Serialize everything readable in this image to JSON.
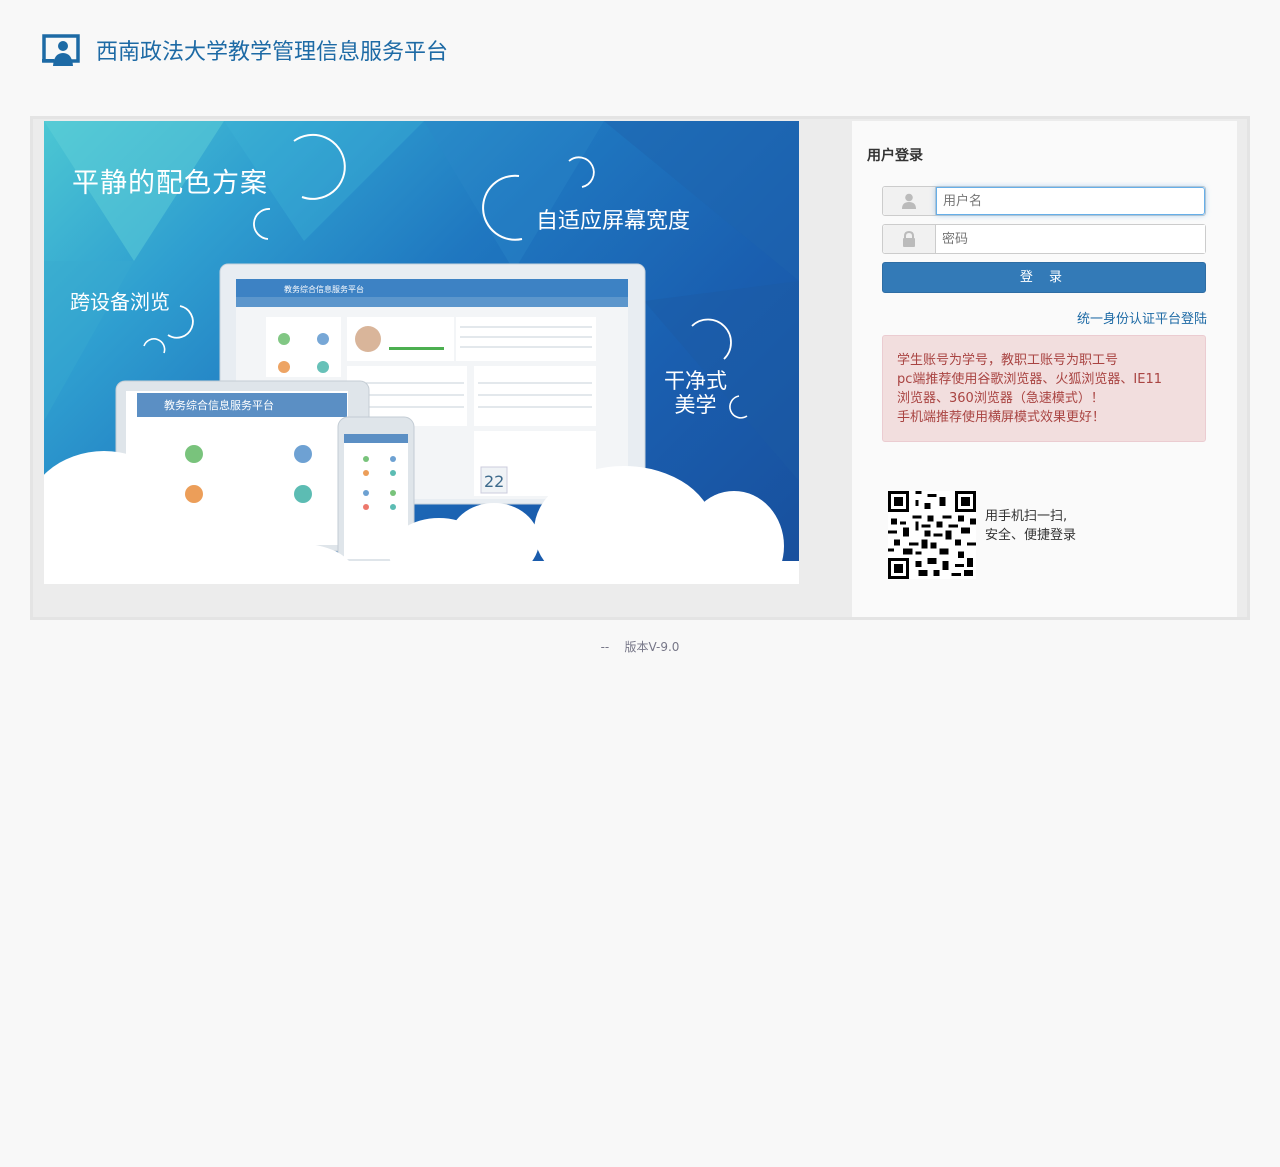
{
  "header": {
    "logo_icon": "presentation-user-icon",
    "title": "西南政法大学教学管理信息服务平台"
  },
  "banner": {
    "slogan_1": "平静的配色方案",
    "slogan_2": "自适应屏幕宽度",
    "slogan_3": "跨设备浏览",
    "slogan_4_line1": "干净式",
    "slogan_4_line2": "美学",
    "device_title_desktop": "教务综合信息服务平台",
    "device_title_tablet": "教务综合信息服务平台",
    "calendar_day": "22"
  },
  "login": {
    "title": "用户登录",
    "username_placeholder": "用户名",
    "password_placeholder": "密码",
    "username_icon": "user-icon",
    "password_icon": "lock-icon",
    "submit_label": "登 录",
    "sso_link": "统一身份认证平台登陆",
    "notice": [
      "学生账号为学号，教职工账号为职工号",
      "pc端推荐使用谷歌浏览器、火狐浏览器、IE11",
      "浏览器、360浏览器（急速模式）！",
      "手机端推荐使用横屏模式效果更好！"
    ],
    "qr_icon": "qr-code-icon",
    "qr_text_line1": "用手机扫一扫,",
    "qr_text_line2": "安全、便捷登录"
  },
  "footer": {
    "version": "--    版本V-9.0"
  },
  "colors": {
    "brand": "#1d6aa5",
    "button": "#337ab7",
    "notice_bg": "#f2dede",
    "notice_text": "#a94442"
  }
}
